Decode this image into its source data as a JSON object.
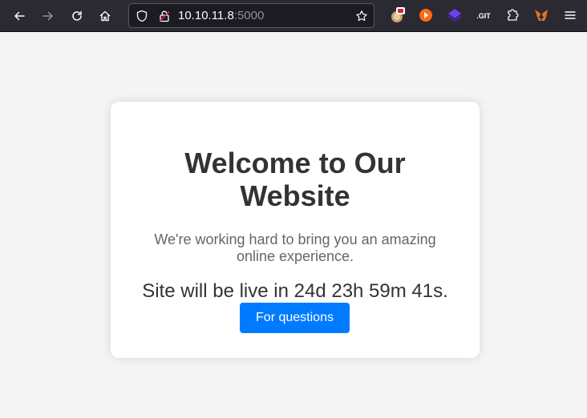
{
  "browser": {
    "url_host": "10.10.11.8",
    "url_port": ":5000",
    "icons": {
      "back": "back-arrow-icon",
      "forward": "forward-arrow-icon",
      "reload": "reload-icon",
      "home": "home-icon",
      "shield": "tracking-protection-shield-icon",
      "lock": "insecure-lock-icon",
      "bookmark": "bookmark-star-icon",
      "extensions": "extensions-puzzle-icon",
      "menu": "hamburger-menu-icon"
    },
    "colors": {
      "toolbar_bg": "#2b2a33",
      "urlbar_bg": "#1c1b22",
      "icon_fg": "#fbfbfe"
    }
  },
  "page": {
    "heading": "Welcome to Our Website",
    "subtext": "We're working hard to bring you an amazing online experience.",
    "countdown": "Site will be live in 24d 23h 59m 41s.",
    "button_label": "For questions",
    "colors": {
      "background": "#f4f4f4",
      "card": "#ffffff",
      "button": "#007bff"
    }
  }
}
